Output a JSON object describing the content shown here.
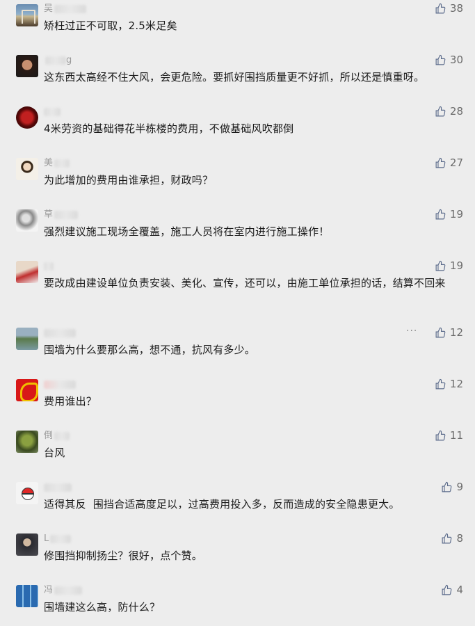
{
  "comments": [
    {
      "name": "吴",
      "text": "矫枉过正不可取，2.5米足矣",
      "likes": "38",
      "avatar_color": "#4a6a8a"
    },
    {
      "name": "",
      "name_tail": "g",
      "text": "这东西太高经不住大风，会更危险。要抓好围挡质量更不好抓，所以还是慎重呀。",
      "likes": "30",
      "avatar_color": "#3a2a22"
    },
    {
      "name": "",
      "text": "4米劳资的基础得花半栋楼的费用，不做基础风吹都倒",
      "likes": "28",
      "avatar_color": "#7a1010"
    },
    {
      "name": "美",
      "text": "为此增加的费用由谁承担，财政吗？",
      "likes": "27",
      "avatar_color": "#d8c8a0"
    },
    {
      "name": "草",
      "text": "强烈建议施工现场全覆盖，施工人员将在室内进行施工操作！",
      "likes": "19",
      "avatar_color": "#b0b0b0"
    },
    {
      "name": "",
      "text": "要改成由建设单位负责安装、美化、宣传，还可以，由施工单位承担的话，结算不回来",
      "likes": "19",
      "avatar_color": "#c84040"
    },
    {
      "name": "",
      "text": "围墙为什么要那么高，想不通，抗风有多少。",
      "likes": "12",
      "avatar_color": "#6a8a5a",
      "more": "···"
    },
    {
      "name": "",
      "text": "费用谁出？",
      "likes": "12",
      "avatar_color": "#d82020"
    },
    {
      "name": "倒",
      "text": "台风",
      "likes": "11",
      "avatar_color": "#5a6a3a"
    },
    {
      "name": "",
      "text": "适得其反  围挡合适高度足以，过高费用投入多，反而造成的安全隐患更大。",
      "likes": "9",
      "avatar_color": "#e84040"
    },
    {
      "name": "L",
      "text": "修围挡抑制扬尘？很好，点个赞。",
      "likes": "8",
      "avatar_color": "#2a2a2a"
    },
    {
      "name": "冯",
      "text": "围墙建这么高，防什么？",
      "likes": "4",
      "avatar_color": "#3a7aba"
    }
  ]
}
